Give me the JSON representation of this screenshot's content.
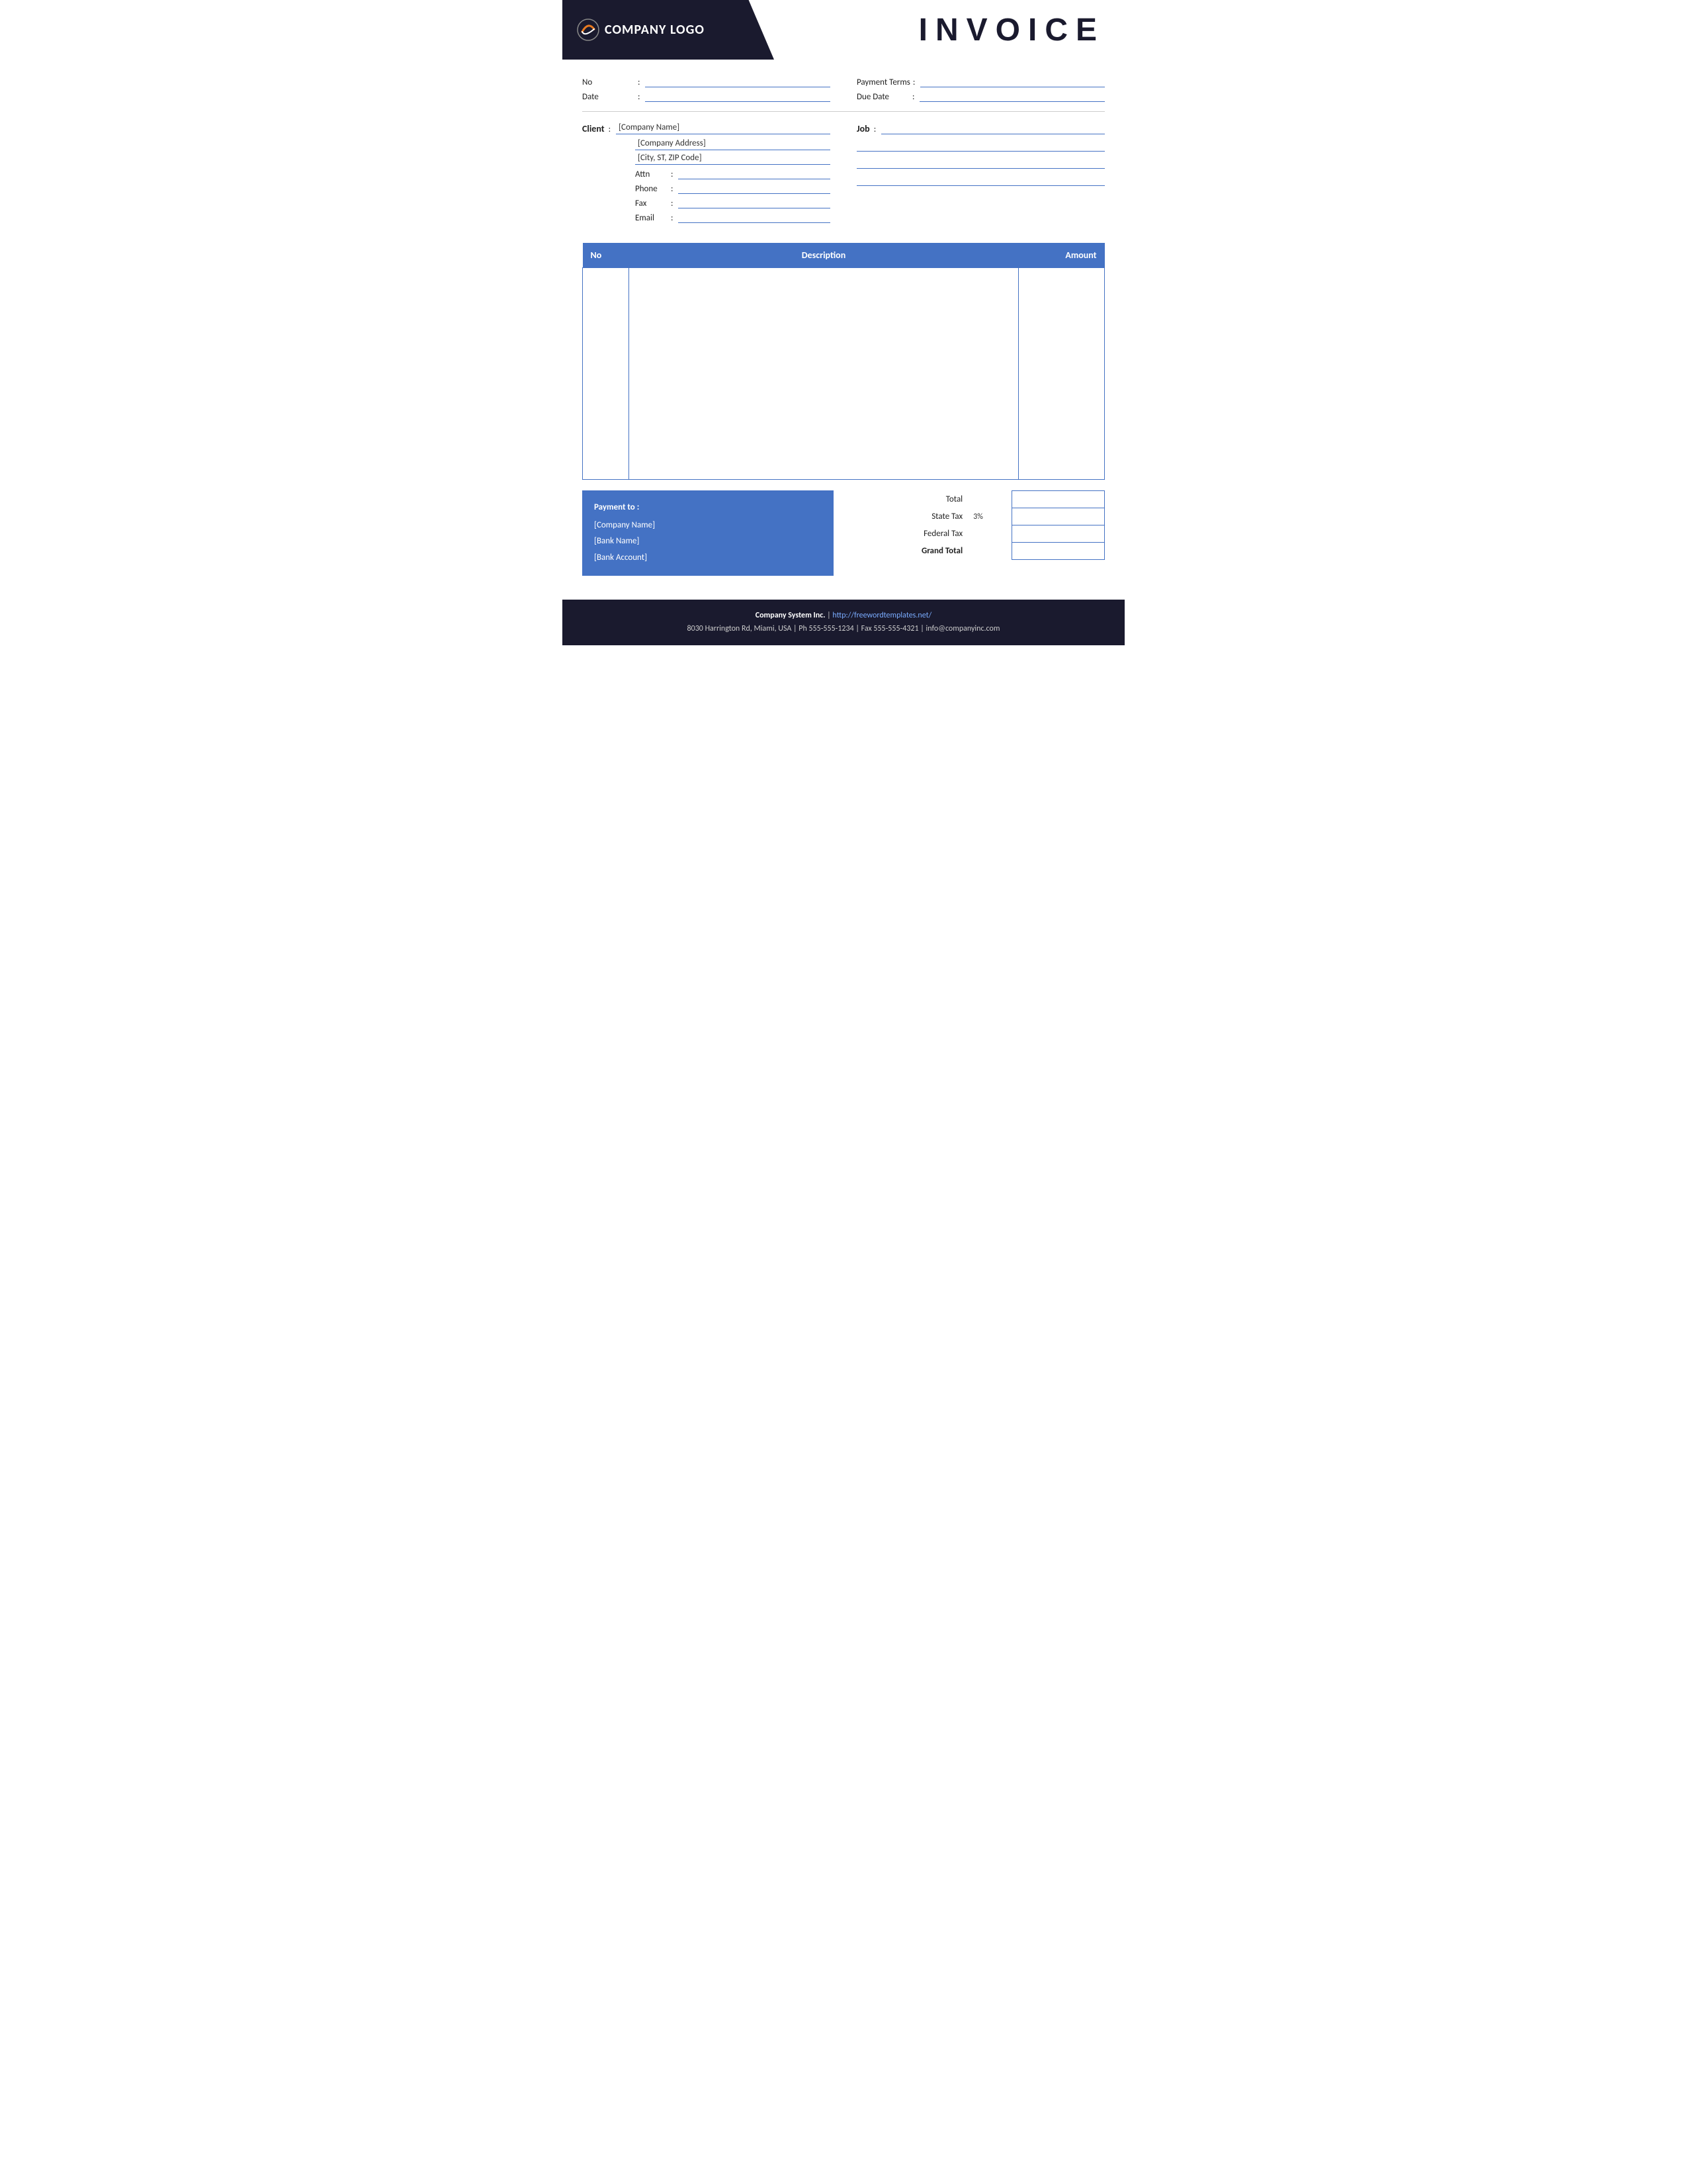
{
  "header": {
    "logo_text": "COMPANY LOGO",
    "title": "INVOICE"
  },
  "meta": {
    "no_label": "No",
    "no_colon": ":",
    "date_label": "Date",
    "date_colon": ":",
    "payment_terms_label": "Payment  Terms",
    "payment_terms_colon": ":",
    "due_date_label": "Due Date",
    "due_date_colon": ":"
  },
  "client": {
    "label": "Client",
    "colon": ":",
    "company_name": "[Company Name]",
    "company_address": "[Company Address]",
    "city_zip": "[City, ST, ZIP Code]",
    "attn_label": "Attn",
    "attn_colon": ":",
    "phone_label": "Phone",
    "phone_colon": ":",
    "fax_label": "Fax",
    "fax_colon": ":",
    "email_label": "Email",
    "email_colon": ":"
  },
  "job": {
    "label": "Job",
    "colon": ":"
  },
  "table": {
    "col_no": "No",
    "col_description": "Description",
    "col_amount": "Amount"
  },
  "payment": {
    "title": "Payment to :",
    "company_name": "[Company Name]",
    "bank_name": "[Bank Name]",
    "bank_account": "[Bank Account]"
  },
  "totals": {
    "total_label": "Total",
    "state_tax_label": "State Tax",
    "state_tax_percent": "3%",
    "federal_tax_label": "Federal Tax",
    "grand_total_label": "Grand Total"
  },
  "footer": {
    "company_name": "Company System Inc.",
    "separator": "|",
    "website": "http://freewordtemplates.net/",
    "address": "8030 Harrington Rd, Miami, USA | Ph 555-555-1234 | Fax 555-555-4321 | info@companyinc.com"
  }
}
